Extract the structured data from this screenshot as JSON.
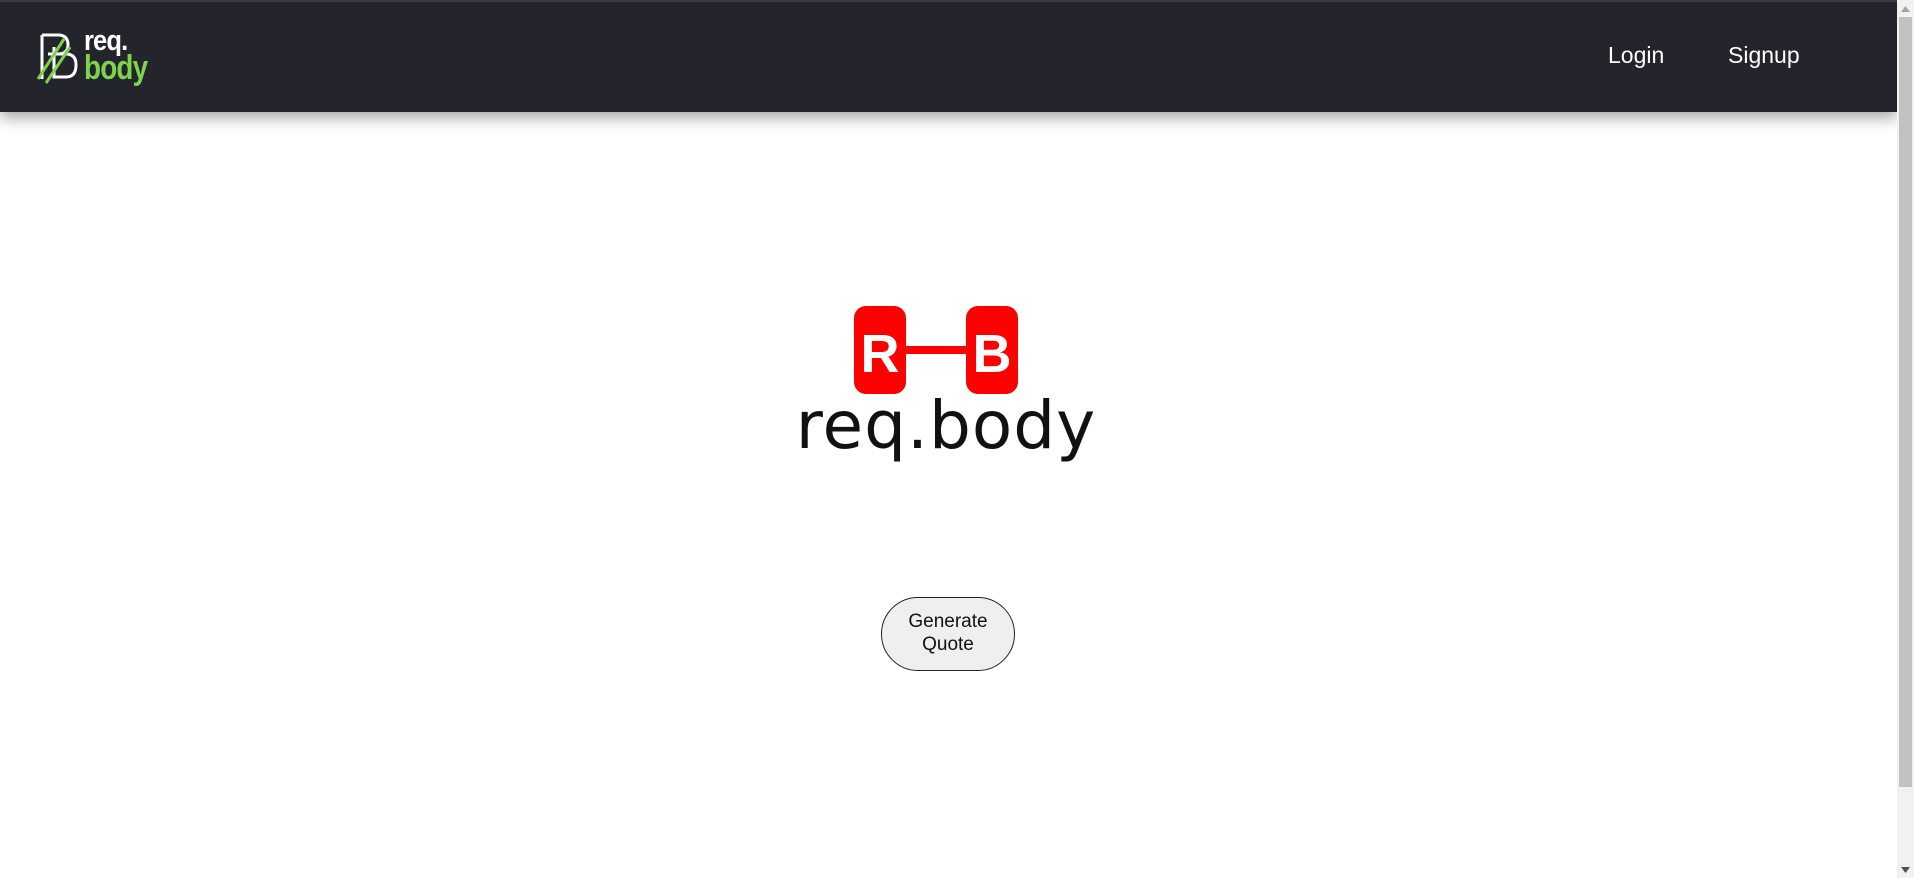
{
  "brand": {
    "line1": "req.",
    "line2": "body",
    "icon": "rb-monogram-icon",
    "colors": {
      "text": "#ffffff",
      "accent": "#7dd34a"
    }
  },
  "nav": {
    "background": "#23242c",
    "items": [
      {
        "label": "Login"
      },
      {
        "label": "Signup"
      }
    ]
  },
  "hero": {
    "logo_letters": [
      "R",
      "B"
    ],
    "logo_wordmark": "req.body",
    "logo_accent": "#ff0000"
  },
  "main": {
    "generate_button": {
      "line1": "Generate",
      "line2": "Quote"
    }
  },
  "scrollbar": {
    "up_icon": "scroll-up-arrow-icon",
    "down_icon": "scroll-down-arrow-icon"
  }
}
